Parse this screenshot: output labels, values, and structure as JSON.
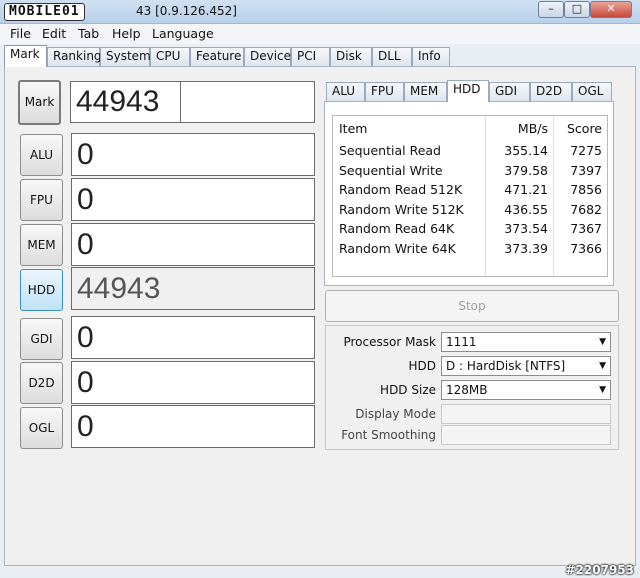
{
  "window": {
    "logo_text": "MOBILE01",
    "title": "43 [0.9.126.452]",
    "controls": {
      "minimize": "–",
      "maximize": "□",
      "close": "✕"
    }
  },
  "menu": [
    "File",
    "Edit",
    "Tab",
    "Help",
    "Language"
  ],
  "top_tabs": [
    "Mark",
    "Ranking",
    "System",
    "CPU",
    "Feature",
    "Device",
    "PCI",
    "Disk",
    "DLL",
    "Info"
  ],
  "active_top_tab": "Mark",
  "scores": {
    "mark": {
      "label": "Mark",
      "value": "44943"
    },
    "alu": {
      "label": "ALU",
      "value": "0"
    },
    "fpu": {
      "label": "FPU",
      "value": "0"
    },
    "mem": {
      "label": "MEM",
      "value": "0"
    },
    "hdd": {
      "label": "HDD",
      "value": "44943"
    },
    "gdi": {
      "label": "GDI",
      "value": "0"
    },
    "d2d": {
      "label": "D2D",
      "value": "0"
    },
    "ogl": {
      "label": "OGL",
      "value": "0"
    }
  },
  "bench_tabs": [
    "ALU",
    "FPU",
    "MEM",
    "HDD",
    "GDI",
    "D2D",
    "OGL"
  ],
  "active_bench_tab": "HDD",
  "table": {
    "headers": [
      "Item",
      "MB/s",
      "Score"
    ],
    "rows": [
      [
        "Sequential Read",
        "355.14",
        "7275"
      ],
      [
        "Sequential Write",
        "379.58",
        "7397"
      ],
      [
        "Random Read 512K",
        "471.21",
        "7856"
      ],
      [
        "Random Write 512K",
        "436.55",
        "7682"
      ],
      [
        "Random Read 64K",
        "373.54",
        "7367"
      ],
      [
        "Random Write 64K",
        "373.39",
        "7366"
      ]
    ]
  },
  "stop_label": "Stop",
  "settings": {
    "processor_mask": {
      "label": "Processor Mask",
      "value": "1111"
    },
    "hdd": {
      "label": "HDD",
      "value": "D : HardDisk [NTFS]"
    },
    "hdd_size": {
      "label": "HDD Size",
      "value": "128MB"
    },
    "display_mode": {
      "label": "Display Mode",
      "value": ""
    },
    "font_smoothing": {
      "label": "Font Smoothing",
      "value": ""
    }
  },
  "watermark": "#2207953",
  "colors": {
    "accent_hdd": "#3c8fc3",
    "title_bar": "#c4d8ee"
  }
}
